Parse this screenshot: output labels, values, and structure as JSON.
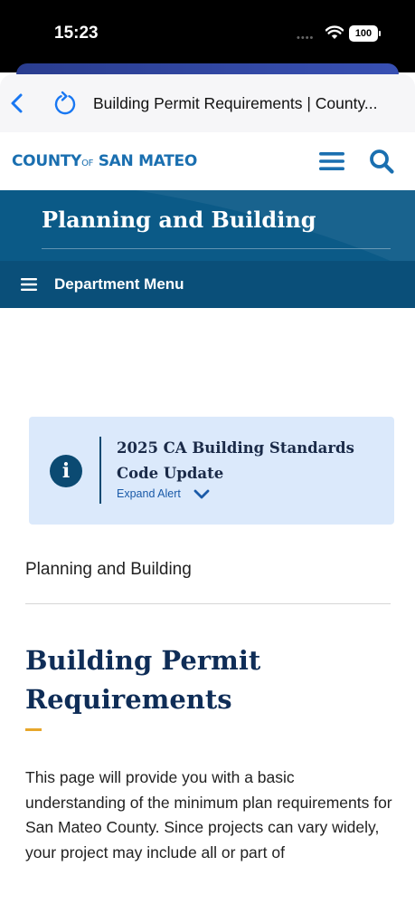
{
  "status_bar": {
    "time": "15:23",
    "battery": "100",
    "icons": [
      "signal-dots-icon",
      "wifi-icon",
      "battery-icon"
    ]
  },
  "browser": {
    "page_title": "Building Permit Requirements | County...",
    "icons": [
      "back-icon",
      "reload-icon"
    ]
  },
  "site_header": {
    "logo_part1": "COUNTY",
    "logo_of": "OF",
    "logo_part2": " SAN MATEO",
    "icons": [
      "menu-icon",
      "search-icon"
    ]
  },
  "banner": {
    "title": "Planning and Building",
    "dept_menu_label": "Department Menu"
  },
  "alert": {
    "title": "2025 CA Building Standards Code Update",
    "expand_label": "Expand Alert",
    "icons": [
      "info-icon",
      "chevron-down-icon"
    ]
  },
  "content": {
    "breadcrumb": "Planning and Building",
    "title": "Building Permit Requirements",
    "intro": "This page will provide you with a basic understanding of the minimum plan requirements for San Mateo County. Since projects can vary widely, your project may include all or part of"
  },
  "colors": {
    "brand_blue": "#1a6fb0",
    "banner_blue": "#0b5a87",
    "alert_bg": "#dbe9fb",
    "heading_navy": "#0f2d57",
    "accent_gold": "#e7a72b"
  }
}
